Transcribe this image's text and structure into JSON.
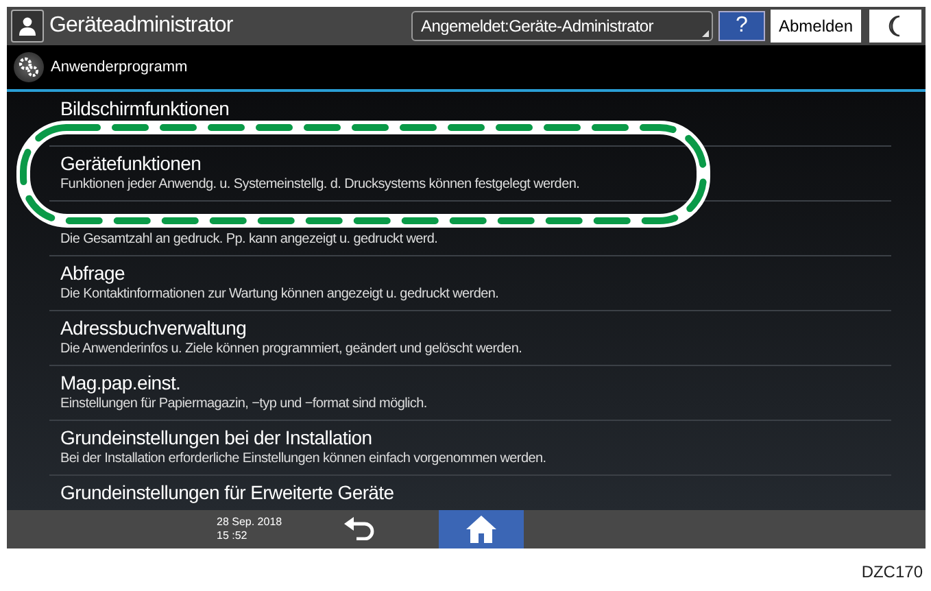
{
  "header": {
    "title": "Geräteadministrator",
    "login_status": "Angemeldet:Geräte-Administrator",
    "help_label": "?",
    "logout_label": "Abmelden"
  },
  "subheader": {
    "title": "Anwenderprogramm"
  },
  "menu_items": [
    {
      "title": "Bildschirmfunktionen"
    },
    {
      "title": "Gerätefunktionen",
      "description": "Funktionen jeder Anwendg. u. Systemeinstellg. d. Drucksystems können festgelegt werden."
    },
    {
      "description": "Die Gesamtzahl an gedruck. Pp. kann angezeigt u. gedruckt werd."
    },
    {
      "title": "Abfrage",
      "description": "Die Kontaktinformationen zur Wartung können angezeigt u. gedruckt werden."
    },
    {
      "title": "Adressbuchverwaltung",
      "description": "Die Anwenderinfos u. Ziele können programmiert, geändert und gelöscht werden."
    },
    {
      "title": "Mag.pap.einst.",
      "description": "Einstellungen für Papiermagazin, −typ und −format sind möglich."
    },
    {
      "title": "Grundeinstellungen bei der Installation",
      "description": "Bei der Installation erforderliche Einstellungen können einfach vorgenommen werden."
    },
    {
      "title": "Grundeinstellungen für Erweiterte Geräte"
    }
  ],
  "footer": {
    "date": "28 Sep. 2018",
    "time": "15 :52"
  },
  "figure_label": "DZC170"
}
